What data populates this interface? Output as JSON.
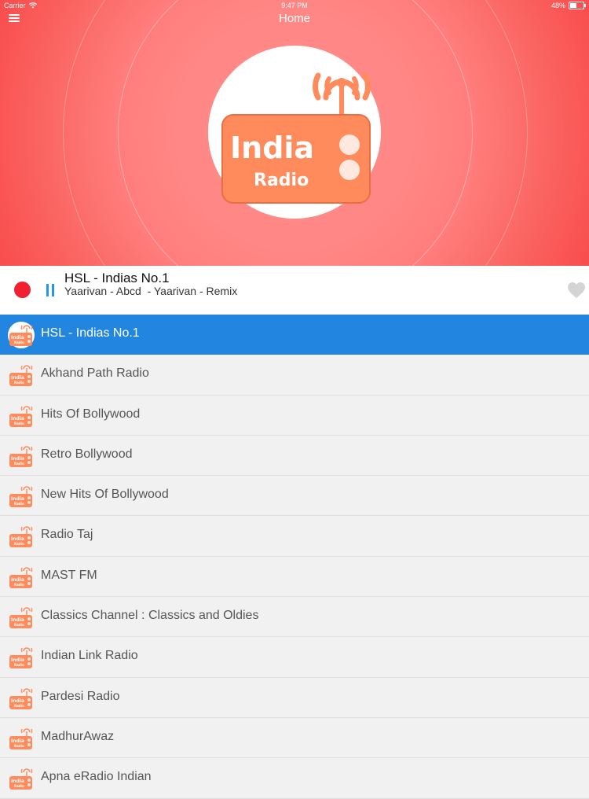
{
  "status_bar": {
    "carrier": "Carrier",
    "time": "9:47 PM",
    "battery": "48%",
    "battery_level": 0.48
  },
  "header": {
    "title": "Home",
    "menu_icon": "hamburger-menu-icon"
  },
  "logo": {
    "line1": "India",
    "line2": "Radio"
  },
  "now_playing": {
    "station": "HSL - Indias No.1",
    "track": "Yaarivan - Abcd  - Yaarivan - Remix",
    "record_icon": "record-icon",
    "pause_icon": "pause-icon",
    "favorite_icon": "heart-icon"
  },
  "stations": [
    {
      "name": "HSL - Indias No.1",
      "active": true
    },
    {
      "name": "Akhand Path Radio",
      "active": false
    },
    {
      "name": "Hits Of Bollywood",
      "active": false
    },
    {
      "name": "Retro Bollywood",
      "active": false
    },
    {
      "name": "New Hits Of Bollywood",
      "active": false
    },
    {
      "name": "Radio Taj",
      "active": false
    },
    {
      "name": "MAST FM",
      "active": false
    },
    {
      "name": "Classics Channel : Classics and Oldies",
      "active": false
    },
    {
      "name": "Indian Link Radio",
      "active": false
    },
    {
      "name": "Pardesi Radio",
      "active": false
    },
    {
      "name": "MadhurAwaz",
      "active": false
    },
    {
      "name": "Apna eRadio Indian",
      "active": false
    }
  ],
  "colors": {
    "accent": "#2286e0",
    "logo_orange": "#ff8a5b",
    "record_red": "#f02030"
  }
}
